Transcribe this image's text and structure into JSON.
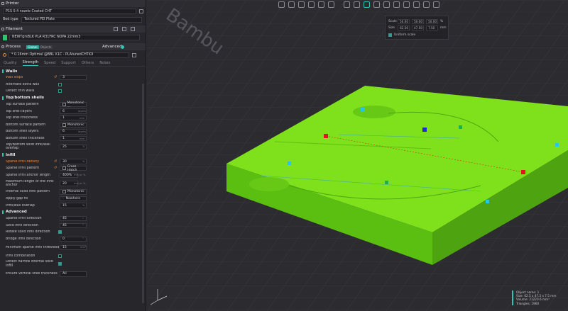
{
  "printer": {
    "section_title": "Printer",
    "printer_name": "P1S 0.4 nozzle Coated CHT",
    "bed_type_label": "Bed type",
    "bed_type_value": "Textured PEI Plate"
  },
  "filament": {
    "section_title": "Filament",
    "filament_name": "NEWTgrsBLK PLA  R31FRC NOPA 22mm3",
    "color": "#2ec46a"
  },
  "process": {
    "section_title": "Process",
    "toggle_global": "Global",
    "toggle_objects": "Objects",
    "advanced_label": "Advanced",
    "profile": "* 0.16mm Optimal @BBL X1C - PLAtunedCHTIOI"
  },
  "tabs": [
    "Quality",
    "Strength",
    "Speed",
    "Support",
    "Others",
    "Notes"
  ],
  "active_tab": "Strength",
  "walls": {
    "title": "Walls",
    "wall_loops": {
      "label": "Wall loops",
      "value": "3"
    },
    "alternate_extra_wall": {
      "label": "Alternate extra wall"
    },
    "detect_thin_walls": {
      "label": "Detect thin walls"
    }
  },
  "top_bottom": {
    "title": "Top/bottom shells",
    "top_surface_pattern": {
      "label": "Top surface pattern",
      "value": "Monotonic ..."
    },
    "top_shell_layers": {
      "label": "Top shell layers",
      "value": "6",
      "unit": "layers"
    },
    "top_shell_thickness": {
      "label": "Top shell thickness",
      "value": "1",
      "unit": "mm"
    },
    "bottom_surface_pattern": {
      "label": "Bottom surface pattern",
      "value": "Monotonic"
    },
    "bottom_shell_layers": {
      "label": "Bottom shell layers",
      "value": "6",
      "unit": "layers"
    },
    "bottom_shell_thickness": {
      "label": "Bottom shell thickness",
      "value": "1",
      "unit": "mm"
    },
    "solid_infill_overlap": {
      "label": "Top/Bottom solid infill/wall overlap",
      "value": "25",
      "unit": "%"
    }
  },
  "infill": {
    "title": "Infill",
    "sparse_density": {
      "label": "Sparse infill density",
      "value": "30",
      "unit": "%"
    },
    "sparse_pattern": {
      "label": "Sparse infill pattern",
      "value": "Cross Hatch"
    },
    "anchor_length": {
      "label": "Sparse infill anchor length",
      "value": "400%",
      "unit": "mm or %"
    },
    "max_anchor": {
      "label": "Maximum length of the infill anchor",
      "value": "20",
      "unit": "mm or %"
    },
    "internal_solid_pattern": {
      "label": "Internal solid infill pattern",
      "value": "Monotonic"
    },
    "gap_fill": {
      "label": "Apply gap fill",
      "value": "Nowhere"
    },
    "wall_overlap": {
      "label": "Infill/wall overlap",
      "value": "15",
      "unit": "%"
    }
  },
  "advanced": {
    "title": "Advanced",
    "sparse_direction": {
      "label": "Sparse infill direction",
      "value": "45",
      "unit": "°"
    },
    "solid_direction": {
      "label": "Solid infill direction",
      "value": "45",
      "unit": "°"
    },
    "rotate_solid": {
      "label": "Rotate solid infill direction"
    },
    "bridge_direction": {
      "label": "Bridge infill direction",
      "value": "0",
      "unit": "°"
    },
    "min_sparse_threshold": {
      "label": "Minimum sparse infill threshold",
      "value": "15",
      "unit": "mm²"
    },
    "infill_combination": {
      "label": "Infill combination"
    },
    "detect_narrow": {
      "label": "Detect narrow internal solid infill"
    },
    "ensure_vertical": {
      "label": "Ensure vertical shell thickness",
      "value": "All"
    }
  },
  "scale_panel": {
    "scale_label": "Scale",
    "size_label": "Size",
    "scale_values": [
      "50.00",
      "50.00",
      "50.00"
    ],
    "scale_unit": "%",
    "size_values": [
      "62.50",
      "47.50",
      "7.50"
    ],
    "size_unit": "mm",
    "uniform_label": "Uniform scale"
  },
  "bed_logo": "Bambu",
  "object_info": {
    "name": "Object name: 1",
    "size": "Size: 62.5 x 47.5 x 7.5 mm",
    "volume": "Volume: 21220.6 mm³",
    "triangles": "Triangles: 1960"
  },
  "colors": {
    "accent": "#2ec4b6",
    "model_green": "#7fe01c",
    "modified": "#ef8a3a"
  }
}
